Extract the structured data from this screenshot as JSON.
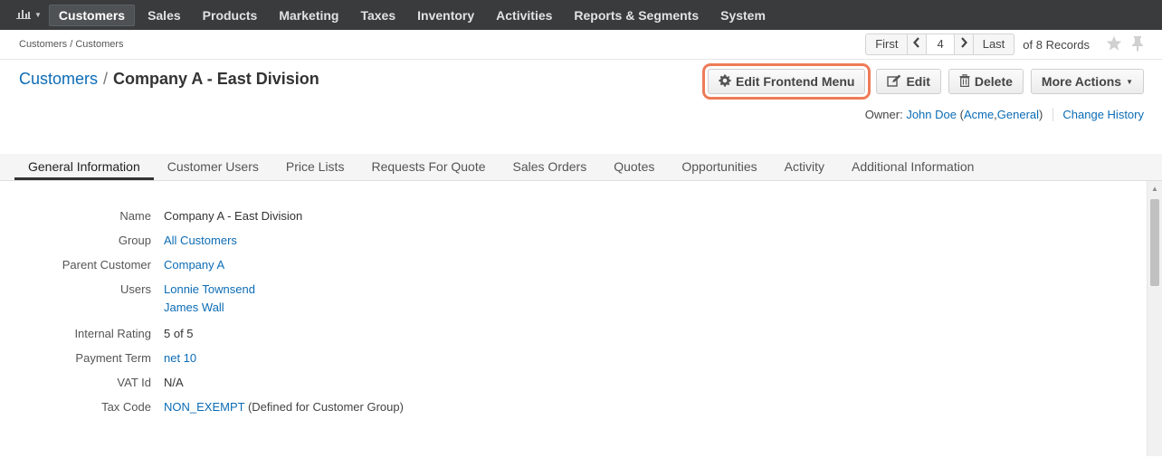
{
  "nav": {
    "items": [
      "Customers",
      "Sales",
      "Products",
      "Marketing",
      "Taxes",
      "Inventory",
      "Activities",
      "Reports & Segments",
      "System"
    ],
    "active": "Customers"
  },
  "breadcrumb": "Customers / Customers",
  "pager": {
    "first": "First",
    "current": "4",
    "last": "Last",
    "records": "of 8 Records"
  },
  "title": {
    "parent": "Customers",
    "separator": "/",
    "name": "Company A - East Division"
  },
  "actions": {
    "edit_frontend_menu": "Edit Frontend Menu",
    "edit": "Edit",
    "delete": "Delete",
    "more_actions": "More Actions"
  },
  "owner": {
    "label": "Owner:",
    "name": "John Doe",
    "org_open": "(",
    "org1": "Acme",
    "org_sep": ", ",
    "org2": "General",
    "org_close": ")",
    "change_history": "Change History"
  },
  "tabs": [
    "General Information",
    "Customer Users",
    "Price Lists",
    "Requests For Quote",
    "Sales Orders",
    "Quotes",
    "Opportunities",
    "Activity",
    "Additional Information"
  ],
  "fields": {
    "name_label": "Name",
    "name_value": "Company A - East Division",
    "group_label": "Group",
    "group_value": "All Customers",
    "parent_label": "Parent Customer",
    "parent_value": "Company A",
    "users_label": "Users",
    "user1": "Lonnie Townsend",
    "user2": "James Wall",
    "rating_label": "Internal Rating",
    "rating_value": "5 of 5",
    "payment_label": "Payment Term",
    "payment_value": "net 10",
    "vat_label": "VAT Id",
    "vat_value": "N/A",
    "tax_label": "Tax Code",
    "tax_value": "NON_EXEMPT",
    "tax_note": "(Defined for Customer Group)"
  },
  "colors": {
    "nav_bg": "#393b3d",
    "link": "#0c6cb5",
    "highlight": "#ee7b57"
  }
}
